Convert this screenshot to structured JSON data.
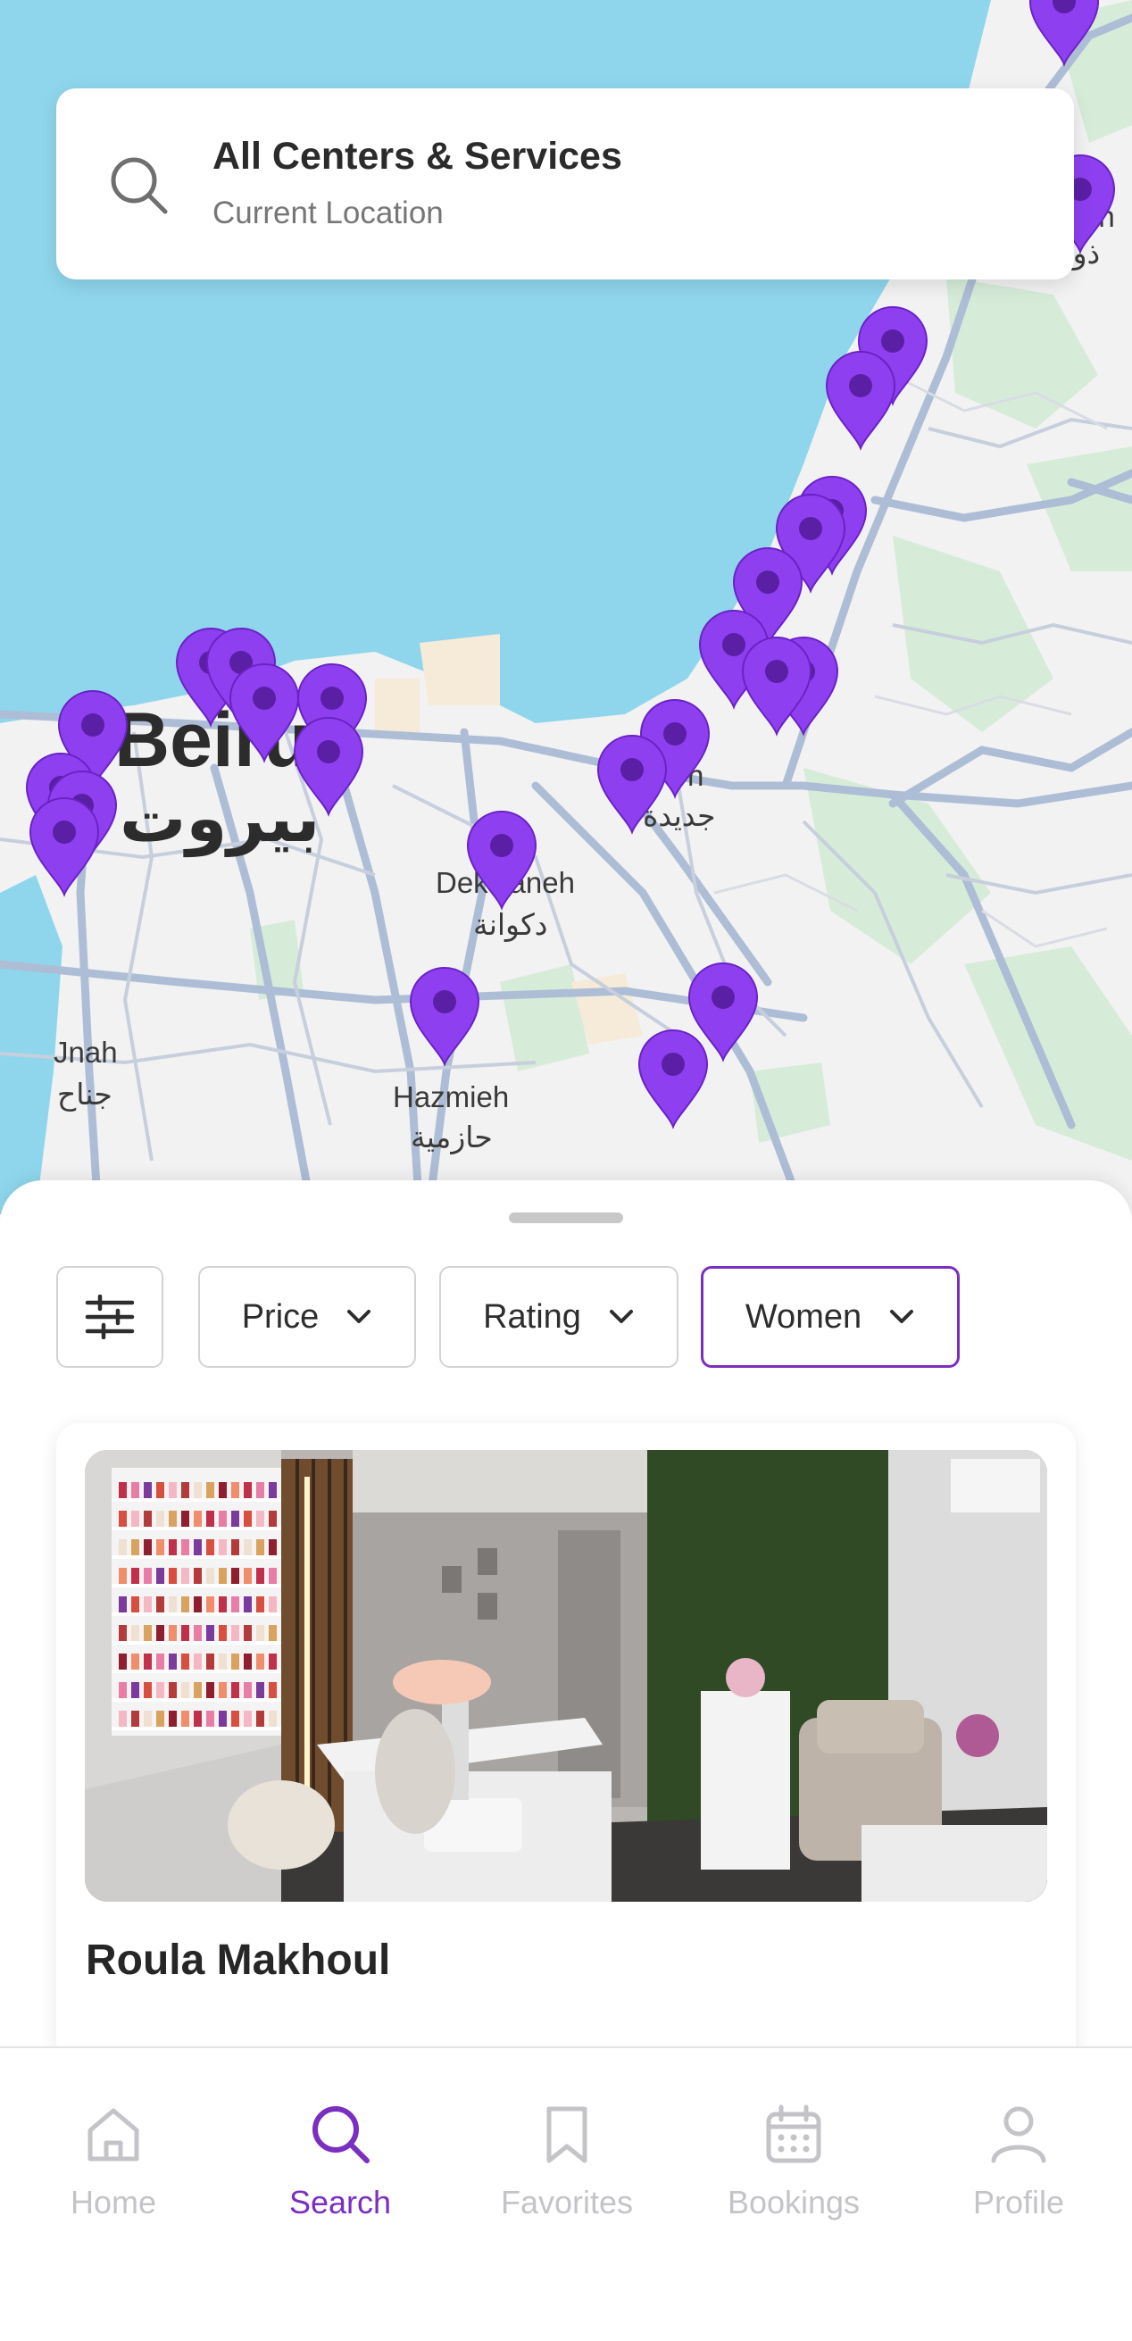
{
  "search": {
    "title": "All Centers & Services",
    "subtitle": "Current Location"
  },
  "map": {
    "labels": {
      "beirut_en": "Beiru",
      "beirut_ar": "بيروت",
      "dekwaneh_en": "Dekwaneh",
      "dekwaneh_ar": "دكوانة",
      "jnah_en": "Jnah",
      "jnah_ar": "جناح",
      "hazmieh_en": "Hazmieh",
      "hazmieh_ar": "حازمية",
      "jdeideh_en": "h",
      "jdeideh_ar": "جديدة",
      "zouk_en": "eh",
      "zouk_ar": "ذوق"
    },
    "pin_color": "#8e3ff0",
    "pin_count": 30
  },
  "filters": {
    "price": "Price",
    "rating": "Rating",
    "gender": "Women"
  },
  "card": {
    "title": "Roula Makhoul"
  },
  "tabs": [
    {
      "label": "Home",
      "icon": "home-icon"
    },
    {
      "label": "Search",
      "icon": "search-icon"
    },
    {
      "label": "Favorites",
      "icon": "bookmark-icon"
    },
    {
      "label": "Bookings",
      "icon": "calendar-icon"
    },
    {
      "label": "Profile",
      "icon": "profile-icon"
    }
  ],
  "colors": {
    "accent": "#7a2fc0",
    "water": "#8fd6ec",
    "park": "#d6ecd9",
    "road": "#aebdd6"
  }
}
